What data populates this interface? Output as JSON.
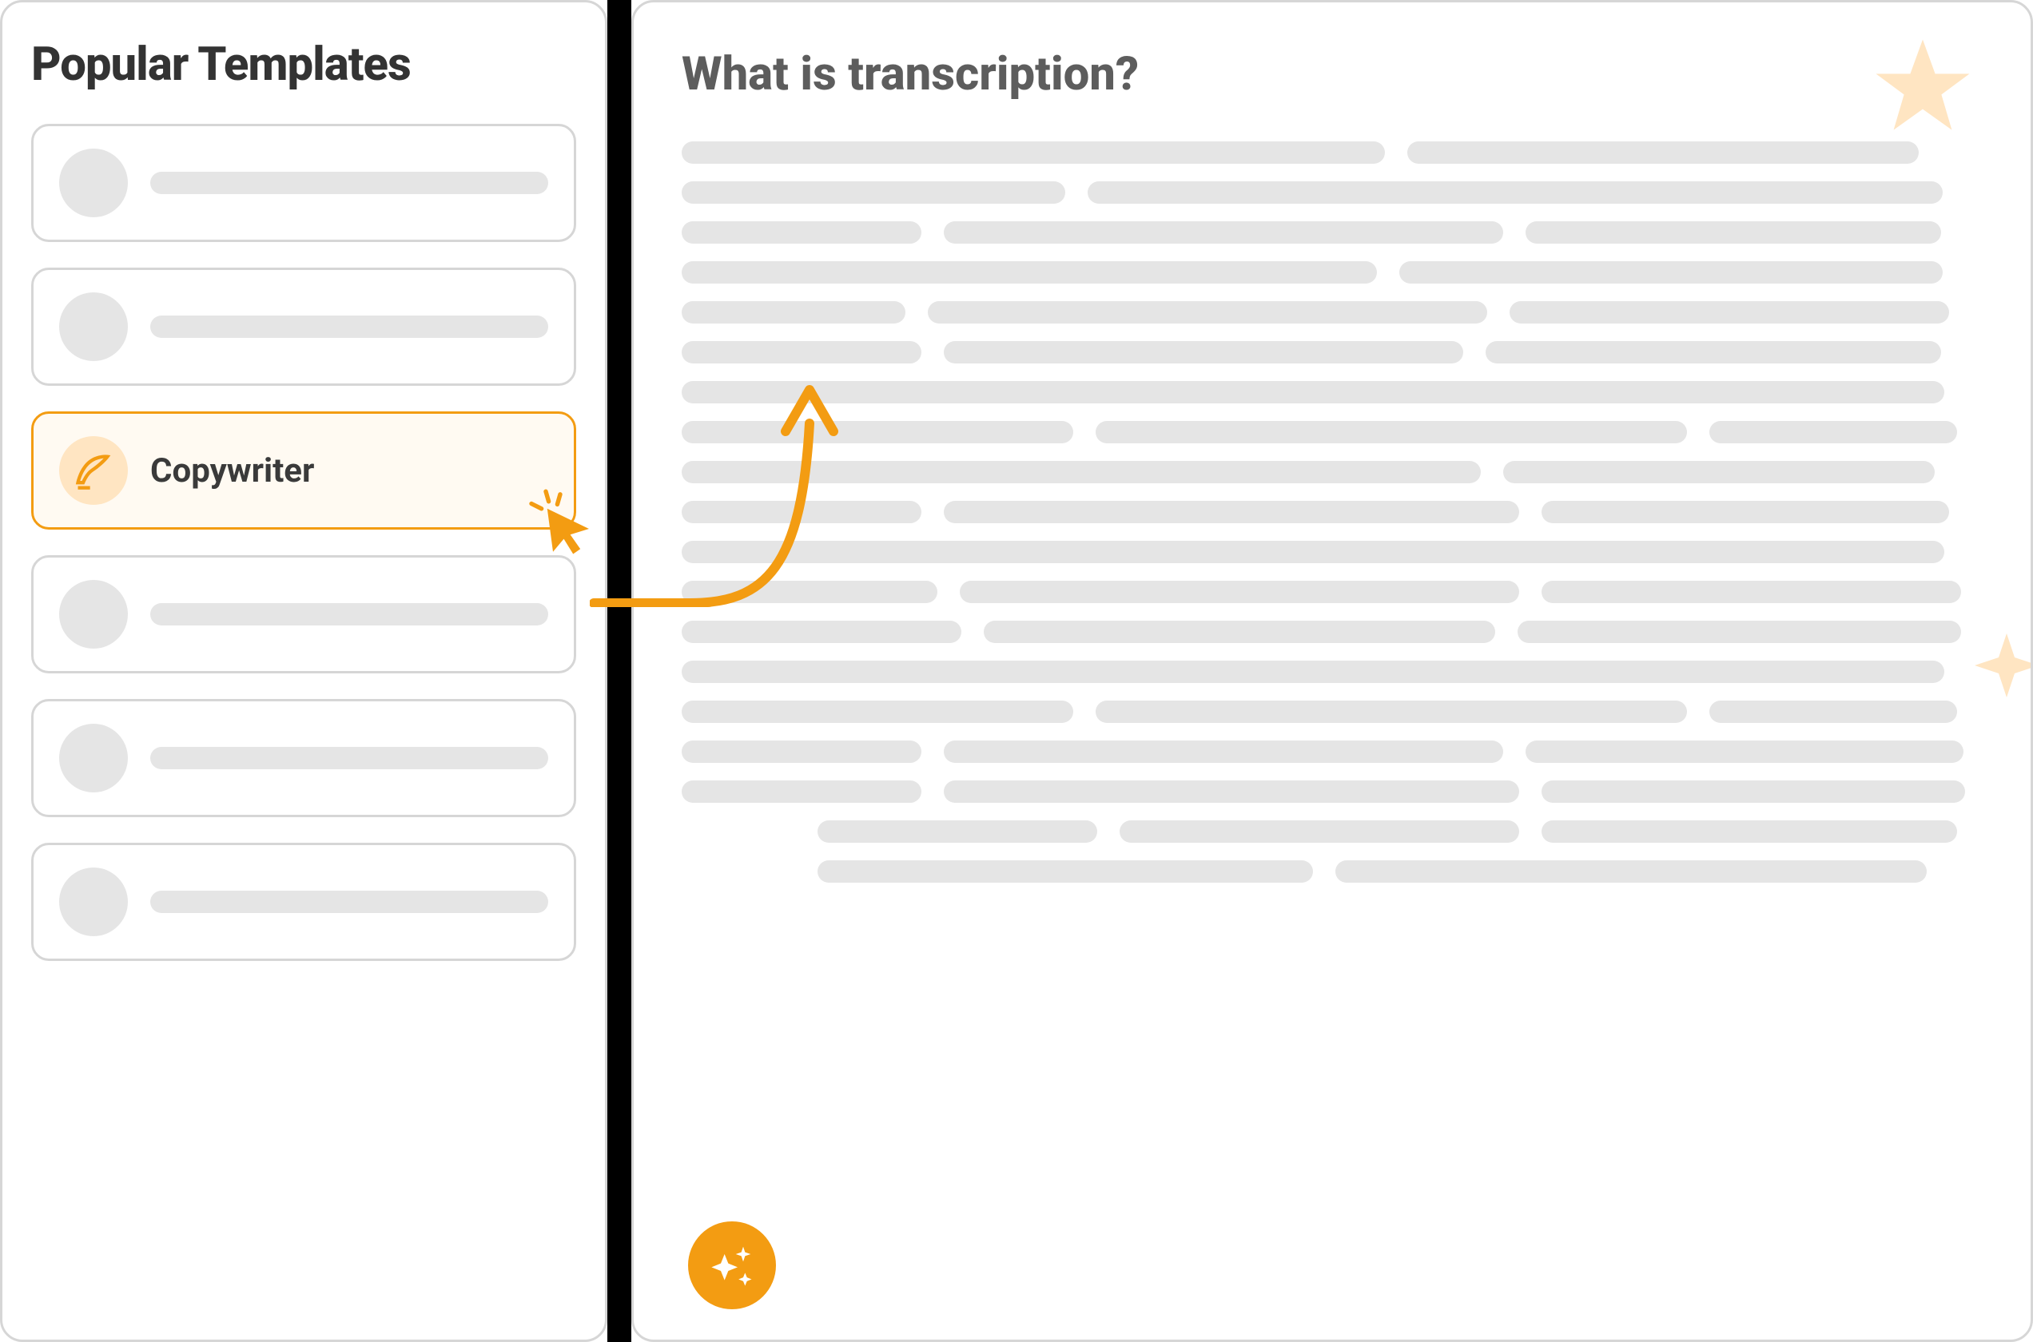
{
  "sidebar": {
    "title": "Popular Templates",
    "items": [
      {
        "label": ""
      },
      {
        "label": ""
      },
      {
        "label": "Copywriter",
        "active": true,
        "icon": "feather"
      },
      {
        "label": ""
      },
      {
        "label": ""
      },
      {
        "label": ""
      }
    ]
  },
  "content": {
    "title": "What is transcription?"
  },
  "colors": {
    "accent": "#f39c12",
    "placeholder": "#e5e5e5",
    "border": "#d6d6d6",
    "titleGray": "#5d5d5d",
    "activeBg": "#fffaf2",
    "starLight": "#ffe5c2"
  }
}
